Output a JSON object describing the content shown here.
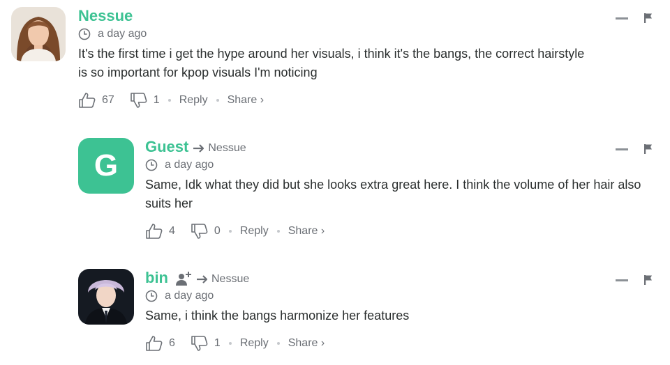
{
  "comments": [
    {
      "author": "Nessue",
      "avatar_type": "photo",
      "time": "a day ago",
      "text": "It's the first time i get the hype around her visuals, i think it's the bangs, the correct hairstyle is so important for kpop visuals I'm noticing",
      "upvotes": "67",
      "downvotes": "1",
      "reply_label": "Reply",
      "share_label": "Share ›"
    },
    {
      "author": "Guest",
      "avatar_type": "letter",
      "avatar_letter": "G",
      "reply_to": "Nessue",
      "time": "a day ago",
      "text": "Same, Idk what they did but she looks extra great here. I think the volume of her hair also suits her",
      "upvotes": "4",
      "downvotes": "0",
      "reply_label": "Reply",
      "share_label": "Share ›"
    },
    {
      "author": "bin",
      "avatar_type": "photo",
      "reply_to": "Nessue",
      "time": "a day ago",
      "text": "Same, i think the bangs harmonize her features",
      "upvotes": "6",
      "downvotes": "1",
      "reply_label": "Reply",
      "share_label": "Share ›"
    }
  ],
  "colors": {
    "accent": "#3dc293",
    "meta": "#6b6f75",
    "text": "#2a2e2e"
  },
  "icons": [
    "clock-icon",
    "thumbs-up-icon",
    "thumbs-down-icon",
    "reply-arrow-icon",
    "follow-user-icon",
    "collapse-icon",
    "flag-icon"
  ]
}
